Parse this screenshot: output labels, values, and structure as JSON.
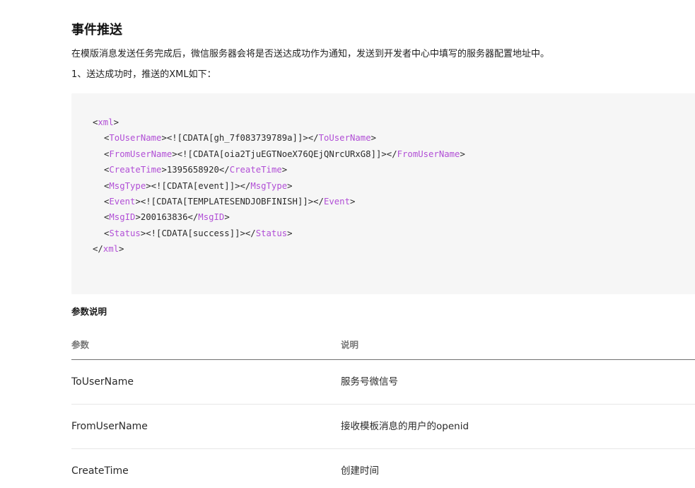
{
  "doc": {
    "heading": "事件推送",
    "intro": "在模版消息发送任务完成后，微信服务器会将是否送达成功作为通知，发送到开发者中心中填写的服务器配置地址中。",
    "step1": "1、送达成功时，推送的XML如下："
  },
  "code": {
    "root_tag": "xml",
    "fields": [
      {
        "tag": "ToUserName",
        "value": "<![CDATA[gh_7f083739789a]]>"
      },
      {
        "tag": "FromUserName",
        "value": "<![CDATA[oia2TjuEGTNoeX76QEjQNrcURxG8]]>"
      },
      {
        "tag": "CreateTime",
        "value": "1395658920"
      },
      {
        "tag": "MsgType",
        "value": "<![CDATA[event]]>"
      },
      {
        "tag": "Event",
        "value": "<![CDATA[TEMPLATESENDJOBFINISH]]>"
      },
      {
        "tag": "MsgID",
        "value": "200163836"
      },
      {
        "tag": "Status",
        "value": "<![CDATA[success]]>"
      }
    ],
    "colors": {
      "tag": "#b14fd6",
      "text": "#2b2b2b",
      "background": "#f6f6f6"
    }
  },
  "params": {
    "label": "参数说明",
    "headers": {
      "param": "参数",
      "desc": "说明"
    },
    "rows": [
      {
        "param": "ToUserName",
        "desc": "服务号微信号"
      },
      {
        "param": "FromUserName",
        "desc": "接收模板消息的用户的openid"
      },
      {
        "param": "CreateTime",
        "desc": "创建时间"
      }
    ]
  }
}
